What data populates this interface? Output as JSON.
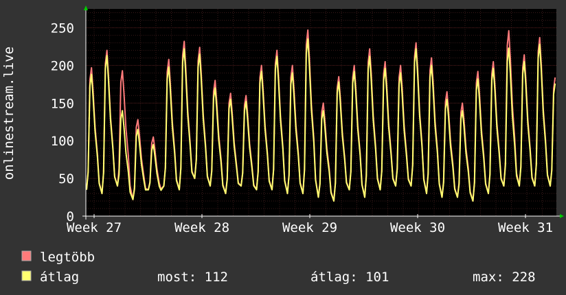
{
  "chart_data": {
    "type": "line",
    "ylabel": "onlinestream.live",
    "ylim": [
      0,
      275
    ],
    "yticks": [
      0,
      50,
      100,
      150,
      200,
      250
    ],
    "xticks": [
      "Week 27",
      "Week 28",
      "Week 29",
      "Week 30",
      "Week 31"
    ],
    "grid": true,
    "legend_position": "bottom-left",
    "colors": {
      "background": "#333333",
      "plot_background": "#000000",
      "grid_minor": "#3a1a1a",
      "grid_major": "#5a2020",
      "axis": "#ffffff",
      "arrow": "#00cc00"
    },
    "series": [
      {
        "name": "legtöbb",
        "color": "#ff7b7b",
        "day_peaks": [
          197,
          220,
          193,
          128,
          105,
          208,
          232,
          224,
          180,
          163,
          160,
          200,
          220,
          200,
          247,
          150,
          185,
          200,
          222,
          205,
          200,
          230,
          210,
          165,
          150,
          192,
          205,
          246,
          214,
          237,
          184,
          125
        ],
        "day_troughs": [
          35,
          30,
          40,
          22,
          35,
          40,
          35,
          50,
          40,
          30,
          40,
          35,
          35,
          30,
          30,
          25,
          20,
          35,
          25,
          35,
          40,
          40,
          30,
          25,
          25,
          20,
          30,
          40,
          40,
          40,
          40,
          40
        ]
      },
      {
        "name": "átlag",
        "color": "#ffff70",
        "day_peaks": [
          188,
          213,
          140,
          115,
          95,
          198,
          222,
          215,
          170,
          155,
          152,
          192,
          212,
          190,
          235,
          140,
          178,
          192,
          212,
          196,
          190,
          222,
          200,
          155,
          140,
          182,
          196,
          223,
          205,
          228,
          176,
          115
        ],
        "day_troughs": [
          35,
          30,
          40,
          22,
          35,
          40,
          35,
          50,
          40,
          30,
          40,
          35,
          35,
          30,
          30,
          25,
          20,
          35,
          25,
          35,
          40,
          40,
          30,
          25,
          25,
          20,
          30,
          40,
          40,
          40,
          40,
          40
        ]
      }
    ]
  },
  "legend": {
    "max_label": "legtöbb",
    "avg_label": "átlag"
  },
  "stats": {
    "most": "most: 112",
    "atlag": "átlag: 101",
    "max": "max: 228"
  }
}
